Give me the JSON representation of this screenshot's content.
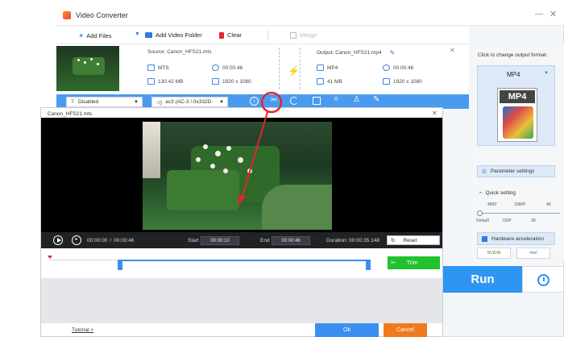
{
  "app": {
    "title": "Video Converter"
  },
  "toolbar": {
    "add_files": "Add Files",
    "add_folder": "Add Video Folder",
    "clear": "Clear",
    "merge": "Merge"
  },
  "file": {
    "source": "Source: Canon_HFS21.mts",
    "output": "Output: Canon_HFS21.mp4",
    "src_format": "MTS",
    "src_duration": "00:00:46",
    "src_size": "130.42 MB",
    "src_res": "1920 x 1080",
    "out_format": "MP4",
    "out_duration": "00:00:46",
    "out_size": "41 MB",
    "out_res": "1920 x 1080"
  },
  "bar": {
    "subtitle": "Disabled",
    "audio": "ac3 (AC-3 / 0x332D·"
  },
  "sidebar": {
    "click_text": "Click to change output format:",
    "format": "MP4",
    "param_btn": "Parameter settings",
    "quick": "Quick setting",
    "q_top": [
      "480P",
      "1080P",
      "4K"
    ],
    "q_bottom": [
      "Default",
      "720P",
      "2K"
    ],
    "hw": "Hardware acceleration",
    "nvidia": "NVIDIA",
    "intel": "intel"
  },
  "run": "Run",
  "dialog": {
    "title": "Canon_HFS21.mts",
    "time_current": "00:00:00",
    "time_sep": "/",
    "time_total": "00:00:46",
    "start_label": "Start",
    "start_val": "00:00:10",
    "end_label": "End",
    "end_val": "00:00:46",
    "duration_label": "Duration:",
    "duration_val": "00:00:35.148",
    "reset": "Reset",
    "trim": "Trim",
    "tutorial": "Tutorial >",
    "ok": "Ok",
    "cancel": "Cancel"
  },
  "colors": {
    "accent": "#3a8ff0",
    "trim_green": "#22c22e",
    "cancel_orange": "#f07a1e",
    "highlight_red": "#e0262e"
  }
}
